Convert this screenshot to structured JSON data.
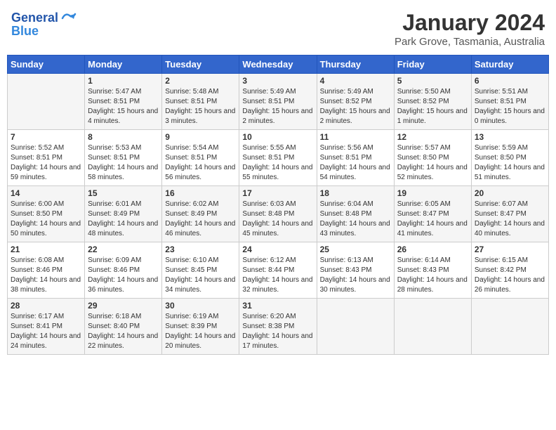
{
  "header": {
    "logo_line1": "General",
    "logo_line2": "Blue",
    "month": "January 2024",
    "location": "Park Grove, Tasmania, Australia"
  },
  "weekdays": [
    "Sunday",
    "Monday",
    "Tuesday",
    "Wednesday",
    "Thursday",
    "Friday",
    "Saturday"
  ],
  "weeks": [
    [
      {
        "day": "",
        "sunrise": "",
        "sunset": "",
        "daylight": ""
      },
      {
        "day": "1",
        "sunrise": "Sunrise: 5:47 AM",
        "sunset": "Sunset: 8:51 PM",
        "daylight": "Daylight: 15 hours and 4 minutes."
      },
      {
        "day": "2",
        "sunrise": "Sunrise: 5:48 AM",
        "sunset": "Sunset: 8:51 PM",
        "daylight": "Daylight: 15 hours and 3 minutes."
      },
      {
        "day": "3",
        "sunrise": "Sunrise: 5:49 AM",
        "sunset": "Sunset: 8:51 PM",
        "daylight": "Daylight: 15 hours and 2 minutes."
      },
      {
        "day": "4",
        "sunrise": "Sunrise: 5:49 AM",
        "sunset": "Sunset: 8:52 PM",
        "daylight": "Daylight: 15 hours and 2 minutes."
      },
      {
        "day": "5",
        "sunrise": "Sunrise: 5:50 AM",
        "sunset": "Sunset: 8:52 PM",
        "daylight": "Daylight: 15 hours and 1 minute."
      },
      {
        "day": "6",
        "sunrise": "Sunrise: 5:51 AM",
        "sunset": "Sunset: 8:51 PM",
        "daylight": "Daylight: 15 hours and 0 minutes."
      }
    ],
    [
      {
        "day": "7",
        "sunrise": "Sunrise: 5:52 AM",
        "sunset": "Sunset: 8:51 PM",
        "daylight": "Daylight: 14 hours and 59 minutes."
      },
      {
        "day": "8",
        "sunrise": "Sunrise: 5:53 AM",
        "sunset": "Sunset: 8:51 PM",
        "daylight": "Daylight: 14 hours and 58 minutes."
      },
      {
        "day": "9",
        "sunrise": "Sunrise: 5:54 AM",
        "sunset": "Sunset: 8:51 PM",
        "daylight": "Daylight: 14 hours and 56 minutes."
      },
      {
        "day": "10",
        "sunrise": "Sunrise: 5:55 AM",
        "sunset": "Sunset: 8:51 PM",
        "daylight": "Daylight: 14 hours and 55 minutes."
      },
      {
        "day": "11",
        "sunrise": "Sunrise: 5:56 AM",
        "sunset": "Sunset: 8:51 PM",
        "daylight": "Daylight: 14 hours and 54 minutes."
      },
      {
        "day": "12",
        "sunrise": "Sunrise: 5:57 AM",
        "sunset": "Sunset: 8:50 PM",
        "daylight": "Daylight: 14 hours and 52 minutes."
      },
      {
        "day": "13",
        "sunrise": "Sunrise: 5:59 AM",
        "sunset": "Sunset: 8:50 PM",
        "daylight": "Daylight: 14 hours and 51 minutes."
      }
    ],
    [
      {
        "day": "14",
        "sunrise": "Sunrise: 6:00 AM",
        "sunset": "Sunset: 8:50 PM",
        "daylight": "Daylight: 14 hours and 50 minutes."
      },
      {
        "day": "15",
        "sunrise": "Sunrise: 6:01 AM",
        "sunset": "Sunset: 8:49 PM",
        "daylight": "Daylight: 14 hours and 48 minutes."
      },
      {
        "day": "16",
        "sunrise": "Sunrise: 6:02 AM",
        "sunset": "Sunset: 8:49 PM",
        "daylight": "Daylight: 14 hours and 46 minutes."
      },
      {
        "day": "17",
        "sunrise": "Sunrise: 6:03 AM",
        "sunset": "Sunset: 8:48 PM",
        "daylight": "Daylight: 14 hours and 45 minutes."
      },
      {
        "day": "18",
        "sunrise": "Sunrise: 6:04 AM",
        "sunset": "Sunset: 8:48 PM",
        "daylight": "Daylight: 14 hours and 43 minutes."
      },
      {
        "day": "19",
        "sunrise": "Sunrise: 6:05 AM",
        "sunset": "Sunset: 8:47 PM",
        "daylight": "Daylight: 14 hours and 41 minutes."
      },
      {
        "day": "20",
        "sunrise": "Sunrise: 6:07 AM",
        "sunset": "Sunset: 8:47 PM",
        "daylight": "Daylight: 14 hours and 40 minutes."
      }
    ],
    [
      {
        "day": "21",
        "sunrise": "Sunrise: 6:08 AM",
        "sunset": "Sunset: 8:46 PM",
        "daylight": "Daylight: 14 hours and 38 minutes."
      },
      {
        "day": "22",
        "sunrise": "Sunrise: 6:09 AM",
        "sunset": "Sunset: 8:46 PM",
        "daylight": "Daylight: 14 hours and 36 minutes."
      },
      {
        "day": "23",
        "sunrise": "Sunrise: 6:10 AM",
        "sunset": "Sunset: 8:45 PM",
        "daylight": "Daylight: 14 hours and 34 minutes."
      },
      {
        "day": "24",
        "sunrise": "Sunrise: 6:12 AM",
        "sunset": "Sunset: 8:44 PM",
        "daylight": "Daylight: 14 hours and 32 minutes."
      },
      {
        "day": "25",
        "sunrise": "Sunrise: 6:13 AM",
        "sunset": "Sunset: 8:43 PM",
        "daylight": "Daylight: 14 hours and 30 minutes."
      },
      {
        "day": "26",
        "sunrise": "Sunrise: 6:14 AM",
        "sunset": "Sunset: 8:43 PM",
        "daylight": "Daylight: 14 hours and 28 minutes."
      },
      {
        "day": "27",
        "sunrise": "Sunrise: 6:15 AM",
        "sunset": "Sunset: 8:42 PM",
        "daylight": "Daylight: 14 hours and 26 minutes."
      }
    ],
    [
      {
        "day": "28",
        "sunrise": "Sunrise: 6:17 AM",
        "sunset": "Sunset: 8:41 PM",
        "daylight": "Daylight: 14 hours and 24 minutes."
      },
      {
        "day": "29",
        "sunrise": "Sunrise: 6:18 AM",
        "sunset": "Sunset: 8:40 PM",
        "daylight": "Daylight: 14 hours and 22 minutes."
      },
      {
        "day": "30",
        "sunrise": "Sunrise: 6:19 AM",
        "sunset": "Sunset: 8:39 PM",
        "daylight": "Daylight: 14 hours and 20 minutes."
      },
      {
        "day": "31",
        "sunrise": "Sunrise: 6:20 AM",
        "sunset": "Sunset: 8:38 PM",
        "daylight": "Daylight: 14 hours and 17 minutes."
      },
      {
        "day": "",
        "sunrise": "",
        "sunset": "",
        "daylight": ""
      },
      {
        "day": "",
        "sunrise": "",
        "sunset": "",
        "daylight": ""
      },
      {
        "day": "",
        "sunrise": "",
        "sunset": "",
        "daylight": ""
      }
    ]
  ]
}
